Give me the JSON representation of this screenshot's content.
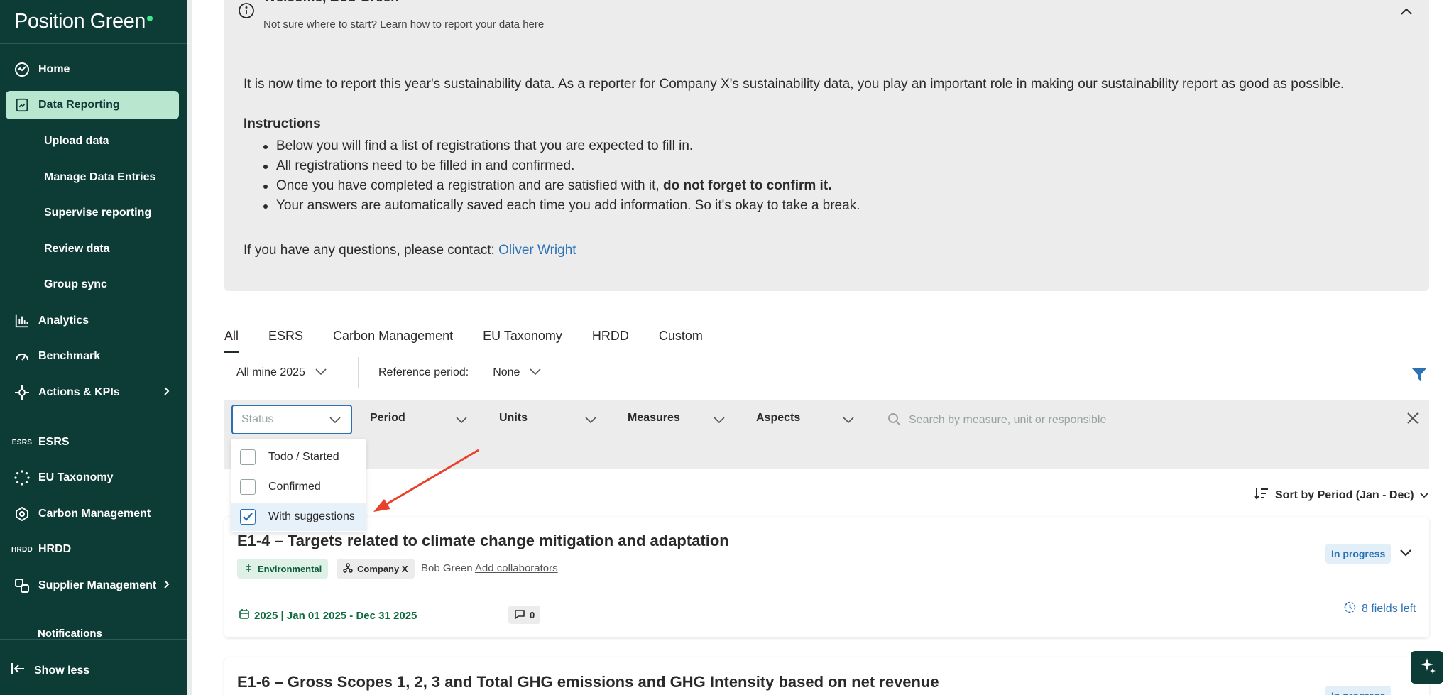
{
  "brand": {
    "name": "Position Green",
    "dot_color": "#3ee88c"
  },
  "sidebar": {
    "items": [
      {
        "label": "Home",
        "icon": "home-icon"
      },
      {
        "label": "Data Reporting",
        "icon": "report-icon",
        "active": true
      },
      {
        "label": "Analytics",
        "icon": "bar-chart-icon"
      },
      {
        "label": "Benchmark",
        "icon": "gauge-icon"
      },
      {
        "label": "Actions & KPIs",
        "icon": "target-icon"
      },
      {
        "label": "ESRS",
        "icon": "ESRS"
      },
      {
        "label": "EU Taxonomy",
        "icon": "dots-circle-icon"
      },
      {
        "label": "Carbon Management",
        "icon": "carbon-icon"
      },
      {
        "label": "HRDD",
        "icon": "HRDD"
      },
      {
        "label": "Supplier Management",
        "icon": "supplier-icon"
      }
    ],
    "sub_items": [
      "Upload data",
      "Manage Data Entries",
      "Supervise reporting",
      "Review data",
      "Group sync"
    ],
    "partial_item": "Notifications",
    "show_less": "Show less"
  },
  "welcome": {
    "title": "Welcome, Bob Green",
    "subtitle": "Not sure where to start? Learn how to report your data here",
    "intro": "It is now time to report this year's sustainability data. As a reporter for Company X's sustainability data, you play an important role in making our sustainability report as good as possible.",
    "instructions_heading": "Instructions",
    "instructions": [
      "Below you will find a list of registrations that you are expected to fill in.",
      "All registrations need to be filled in and confirmed.",
      "Once you have completed a registration and are satisfied with it, ",
      "Your answers are automatically saved each time you add information. So it's okay to take a break."
    ],
    "instruction_bold": "do not forget to confirm it.",
    "contact_text": "If you have any questions, please contact: ",
    "contact_name": "Oliver Wright"
  },
  "tabs": [
    "All",
    "ESRS",
    "Carbon Management",
    "EU Taxonomy",
    "HRDD",
    "Custom"
  ],
  "filters": {
    "scope": "All mine 2025",
    "reference_label": "Reference period:",
    "reference_value": "None",
    "status_placeholder": "Status",
    "period": "Period",
    "units": "Units",
    "measures": "Measures",
    "aspects": "Aspects",
    "search_placeholder": "Search by measure, unit or responsible"
  },
  "status_options": [
    {
      "label": "Todo / Started",
      "checked": false
    },
    {
      "label": "Confirmed",
      "checked": false
    },
    {
      "label": "With suggestions",
      "checked": true
    }
  ],
  "sort": {
    "label": "Sort by Period (Jan - Dec)"
  },
  "cards": [
    {
      "title": "E1-4 – Targets related to climate change mitigation and adaptation",
      "tag_env": "Environmental",
      "tag_company": "Company X",
      "owner": "Bob Green",
      "add_collaborators": "Add collaborators",
      "status": "In progress",
      "period": "2025 | Jan 01 2025 - Dec 31 2025",
      "comments": "0",
      "fields_left": "8 fields left"
    },
    {
      "title": "E1-6 – Gross Scopes 1, 2, 3 and Total GHG emissions and GHG Intensity based on net revenue",
      "status": "In progress"
    }
  ],
  "colors": {
    "sidebar": "#0d3b35",
    "active_nav": "#b8e6cf",
    "link": "#2b72b5",
    "arrow": "#e8412c"
  }
}
